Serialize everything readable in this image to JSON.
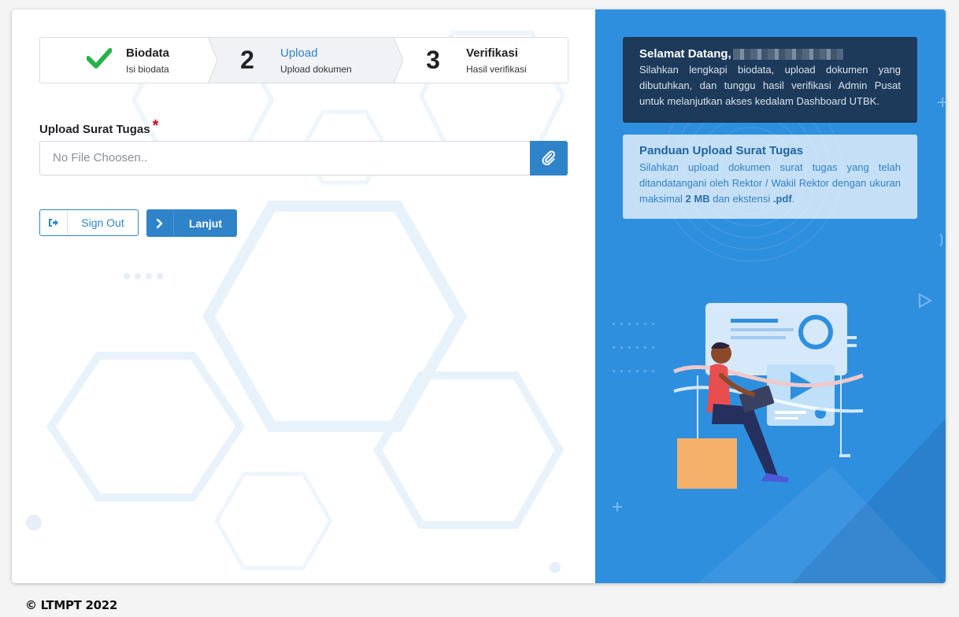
{
  "stepper": {
    "steps": [
      {
        "number": "",
        "title": "Biodata",
        "subtitle": "Isi biodata",
        "status": "done"
      },
      {
        "number": "2",
        "title": "Upload",
        "subtitle": "Upload dokumen",
        "status": "active"
      },
      {
        "number": "3",
        "title": "Verifikasi",
        "subtitle": "Hasil verifikasi",
        "status": "pending"
      }
    ]
  },
  "form": {
    "label": "Upload Surat Tugas",
    "required_mark": "*",
    "file_placeholder": "No File Choosen.."
  },
  "buttons": {
    "signout_label": "Sign Out",
    "next_label": "Lanjut"
  },
  "welcome": {
    "title": "Selamat Datang,",
    "text": "Silahkan lengkapi biodata, upload dokumen yang dibutuhkan, dan tunggu hasil verifikasi Admin Pusat untuk melanjutkan akses kedalam Dashboard UTBK."
  },
  "guide": {
    "title": "Panduan Upload Surat Tugas",
    "text_before": "Silahkan upload dokumen surat tugas yang telah ditandatangani oleh Rektor / Wakil Rektor dengan ukuran maksimal",
    "size": "2 MB",
    "text_mid": "dan ekstensi",
    "ext": ".pdf",
    "text_end": "."
  },
  "footer": {
    "text": "© LTMPT 2022"
  },
  "colors": {
    "primary": "#2f83c9",
    "right_panel": "#2f8fdf",
    "welcome_bg": "#1d3a5a",
    "check": "#27b24a",
    "required": "#d0021b"
  },
  "icons": [
    "check-icon",
    "paperclip-icon",
    "sign-out-icon",
    "chevron-right-icon"
  ]
}
